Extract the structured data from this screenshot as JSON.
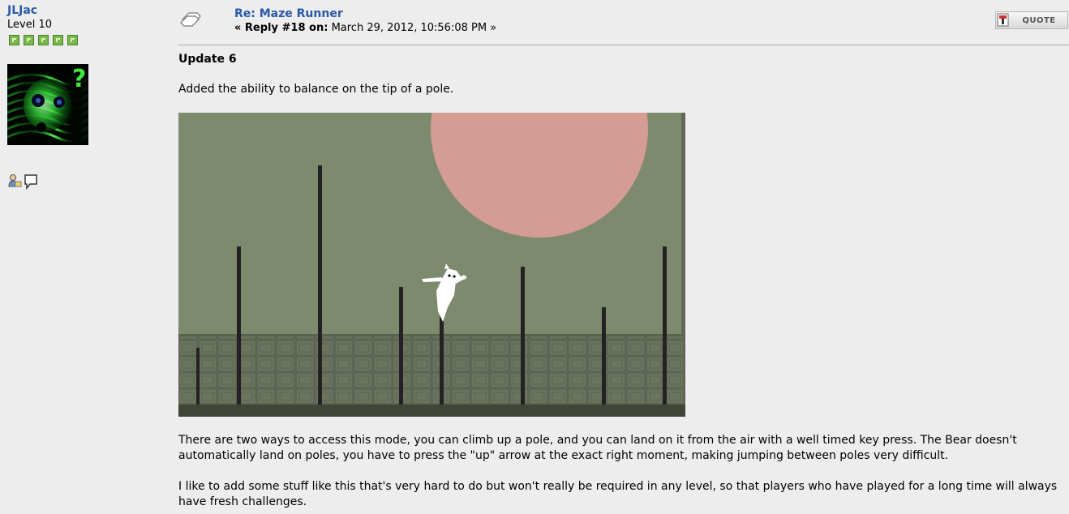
{
  "poster": {
    "name": "JLJac",
    "level": "Level 10",
    "star_count": 5,
    "profile_icon_name": "profile-icon",
    "pm_icon_name": "speech-bubble-icon"
  },
  "post": {
    "title": "Re: Maze Runner",
    "meta_prefix": "« Reply #18 on:",
    "meta_date": "March 29, 2012, 10:56:08 PM »",
    "quote_label": "QUOTE",
    "heading": "Update 6",
    "paragraph1": "Added the ability to balance on the tip of a pole.",
    "paragraph2": "There are two ways to access this mode, you can climb up a pole, and you can land on it from the air with a well timed key press. The Bear doesn't automatically land on poles, you have to press the \"up\" arrow at the exact right moment, making jumping between poles very difficult.",
    "paragraph3": "I like to add some stuff like this that's very hard to do but won't really be required in any level, so that players who have played for a long time will always have fresh challenges."
  },
  "colors": {
    "link": "#2a58a8",
    "background": "#ededed",
    "game_sky": "#7d8a6e",
    "game_sun": "#d59c94",
    "game_floor": "#5f6a55",
    "game_pole": "#222222"
  }
}
